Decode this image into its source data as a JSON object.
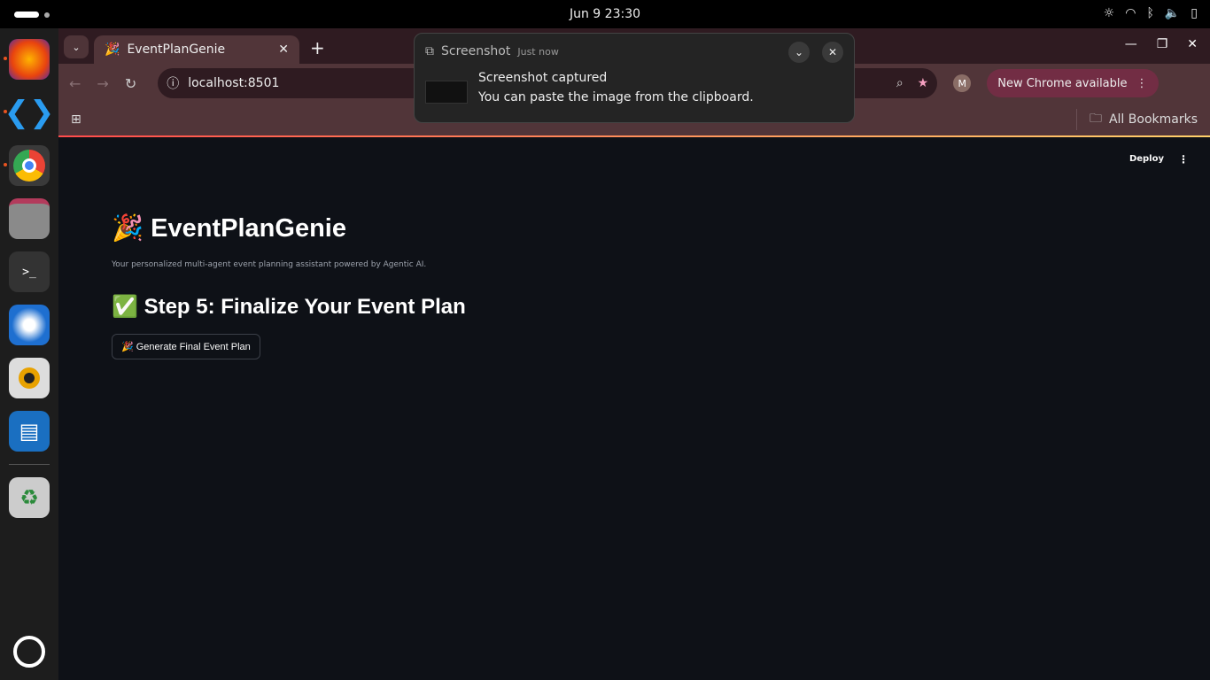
{
  "system": {
    "clock": "Jun 9  23:30"
  },
  "browser": {
    "tab_title": "EventPlanGenie",
    "url": "localhost:8501",
    "profile_initial": "M",
    "update_label": "New Chrome available",
    "bookmarks_label": "All Bookmarks"
  },
  "notification": {
    "app": "Screenshot",
    "time": "Just now",
    "title": "Screenshot captured",
    "body": "You can paste the image from the clipboard."
  },
  "app": {
    "deploy": "Deploy",
    "title": "EventPlanGenie",
    "title_emoji": "🎉",
    "subtitle": "Your personalized multi-agent event planning assistant powered by Agentic AI.",
    "step_emoji": "✅",
    "step_heading": "Step 5: Finalize Your Event Plan",
    "generate_button": "🎉 Generate Final Event Plan"
  },
  "colors": {
    "accent_start": "#ff4b4b",
    "accent_end": "#ffd16a",
    "background": "#0e1117",
    "chrome_frame": "#2f1b21"
  }
}
